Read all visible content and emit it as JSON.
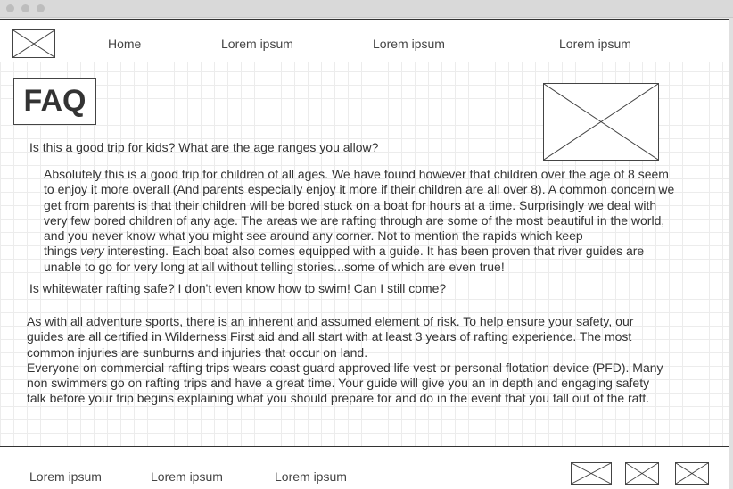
{
  "navbar": {
    "links": [
      "Home",
      "Lorem ipsum",
      "Lorem ipsum",
      "Lorem ipsum"
    ]
  },
  "page": {
    "title": "FAQ"
  },
  "faq": [
    {
      "question": "Is this a good trip for kids? What are the age ranges you allow?",
      "answer_lines": [
        "Absolutely this is a good trip for children of all ages. We have found however that children over the age of 8 seem",
        "to enjoy it more overall (And parents especially enjoy it more if their children are all over 8). A common concern we",
        "get from parents is that their children will be bored stuck on a boat for hours at a time. Surprisingly we deal with",
        "very few bored children of any age. The areas we are rafting through are some of the most beautiful in the world,",
        "and you never know what you might see around any corner. Not to mention the rapids which keep"
      ],
      "answer_emphasis_prefix": "things ",
      "answer_emphasis": "very",
      "answer_emphasis_suffix": " interesting. Each boat also comes equipped with a guide. It has been proven that river guides are",
      "answer_last_line": "unable to go for very long at all without telling stories...some of which are even true!"
    },
    {
      "question": "Is whitewater rafting safe? I don't even know how to swim! Can I still come?",
      "answer_lines": [
        "As with all adventure sports, there is an inherent and assumed element of risk. To help ensure your safety, our",
        "guides are all certified in Wilderness First aid and all start with at least 3 years of rafting experience. The most",
        "common injuries are sunburns and injuries that occur on land.",
        "Everyone on commercial rafting trips wears coast guard approved life vest or personal flotation device (PFD). Many",
        "non swimmers go on rafting trips and have a great time. Your guide will give you an in depth and engaging safety",
        "talk before your trip begins explaining what you should prepare for and do in the event that you fall out of the raft."
      ]
    }
  ],
  "footer": {
    "links": [
      "Lorem ipsum",
      "Lorem ipsum",
      "Lorem ipsum"
    ]
  }
}
